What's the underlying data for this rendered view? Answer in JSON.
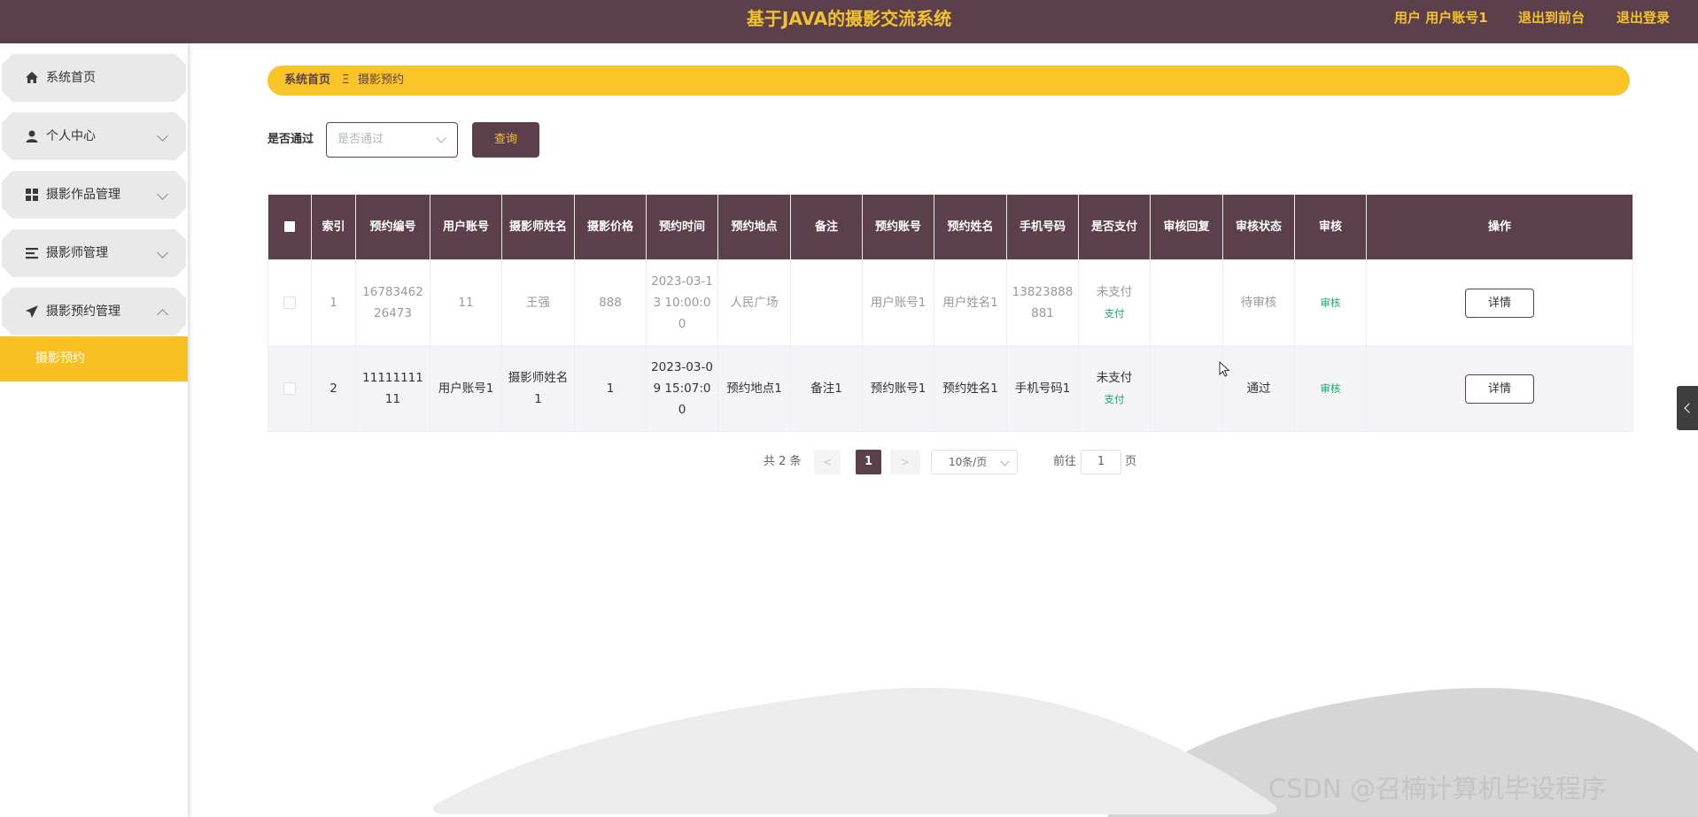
{
  "header": {
    "title": "基于JAVA的摄影交流系统",
    "user_label": "用户 用户账号1",
    "to_frontend": "退出到前台",
    "logout": "退出登录"
  },
  "sidebar": {
    "items": [
      {
        "label": "系统首页",
        "icon": "home-icon"
      },
      {
        "label": "个人中心",
        "icon": "user-icon"
      },
      {
        "label": "摄影作品管理",
        "icon": "grid-icon"
      },
      {
        "label": "摄影师管理",
        "icon": "list-icon"
      },
      {
        "label": "摄影预约管理",
        "icon": "send-icon"
      }
    ],
    "active_sub": "摄影预约"
  },
  "breadcrumb": {
    "home": "系统首页",
    "separator": "Ξ",
    "current": "摄影预约"
  },
  "search": {
    "label": "是否通过",
    "placeholder": "是否通过",
    "button": "查询"
  },
  "table": {
    "headers": [
      "索引",
      "预约编号",
      "用户账号",
      "摄影师姓名",
      "摄影价格",
      "预约时间",
      "预约地点",
      "备注",
      "预约账号",
      "预约姓名",
      "手机号码",
      "是否支付",
      "审核回复",
      "审核状态",
      "审核",
      "操作"
    ],
    "rows": [
      {
        "index": "1",
        "order_no": "1678346226473",
        "user_account": "11",
        "photographer": "王强",
        "price": "888",
        "time": "2023-03-13 10:00:00",
        "place": "人民广场",
        "remark": "",
        "booking_account": "用户账号1",
        "booking_name": "用户姓名1",
        "phone": "13823888881",
        "paid": "未支付",
        "pay_link": "支付",
        "reply": "",
        "status": "待审核",
        "audit": "审核",
        "action": "详情"
      },
      {
        "index": "2",
        "order_no": "1111111111",
        "user_account": "用户账号1",
        "photographer": "摄影师姓名1",
        "price": "1",
        "time": "2023-03-09 15:07:00",
        "place": "预约地点1",
        "remark": "备注1",
        "booking_account": "预约账号1",
        "booking_name": "预约姓名1",
        "phone": "手机号码1",
        "paid": "未支付",
        "pay_link": "支付",
        "reply": "",
        "status": "通过",
        "audit": "审核",
        "action": "详情"
      }
    ]
  },
  "pagination": {
    "total": "共 2 条",
    "prev": "<",
    "current": "1",
    "next": ">",
    "page_size": "10条/页",
    "goto_prefix": "前往",
    "goto_value": "1",
    "goto_suffix": "页"
  },
  "watermark": "CSDN @召楠计算机毕设程序",
  "colors": {
    "brand": "#5b3f4b",
    "accent": "#f9c426",
    "success": "#1ea86a"
  }
}
